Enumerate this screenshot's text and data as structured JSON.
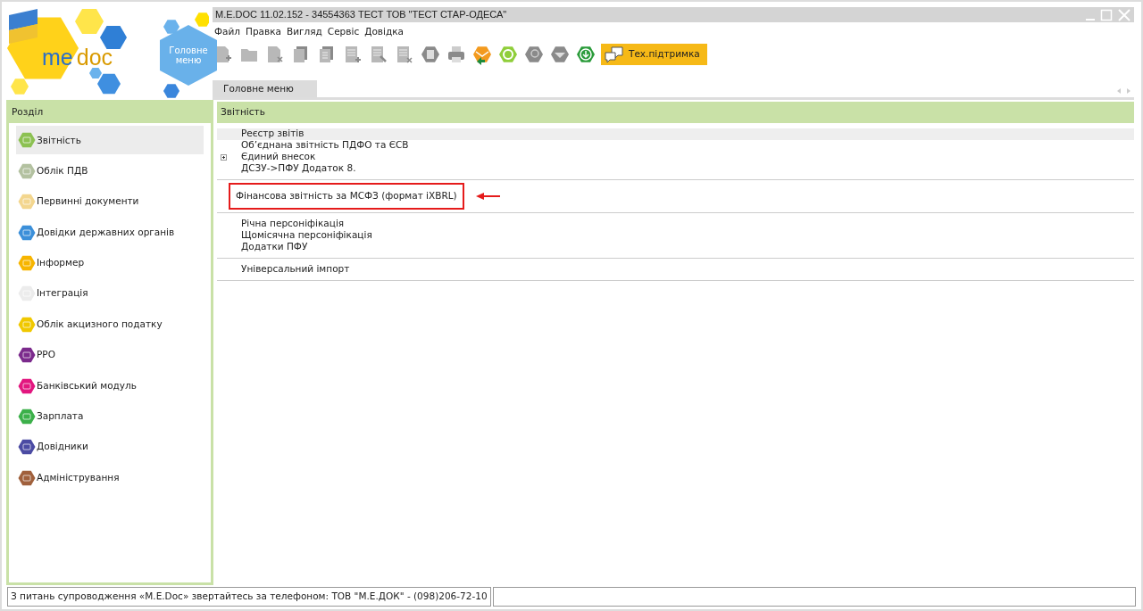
{
  "logo": {
    "text_me": "me",
    "text_doc": "doc"
  },
  "main_menu_button": {
    "line_1": "Головне",
    "line_2": "меню"
  },
  "window": {
    "title": "M.E.DOC 11.02.152  - 34554363 ТЕСТ ТОВ \"ТЕСТ СТАР-ОДЕСА\""
  },
  "menu": [
    "Файл",
    "Правка",
    "Вигляд",
    "Сервіс",
    "Довідка"
  ],
  "support_button": {
    "label": "Тех.підтримка"
  },
  "tabs": [
    {
      "label": "Головне меню",
      "selected": true
    }
  ],
  "sidebar": {
    "title": "Розділ",
    "items": [
      {
        "label": "Звітність",
        "selected": true,
        "color": "#8cc152"
      },
      {
        "label": "Облік ПДВ",
        "selected": false,
        "color": "#b3c1a0"
      },
      {
        "label": "Первинні документи",
        "selected": false,
        "color": "#f3d68e"
      },
      {
        "label": "Довідки державних органів",
        "selected": false,
        "color": "#3b8fd9"
      },
      {
        "label": "Інформер",
        "selected": false,
        "color": "#f7b500"
      },
      {
        "label": "Інтеграція",
        "selected": false,
        "color": "#ececec"
      },
      {
        "label": "Облік акцизного податку",
        "selected": false,
        "color": "#f0c800"
      },
      {
        "label": "РРО",
        "selected": false,
        "color": "#7b2a8c"
      },
      {
        "label": "Банківський модуль",
        "selected": false,
        "color": "#e2167f"
      },
      {
        "label": "Зарплата",
        "selected": false,
        "color": "#3cb04a"
      },
      {
        "label": "Довідники",
        "selected": false,
        "color": "#4b4ba3"
      },
      {
        "label": "Адміністрування",
        "selected": false,
        "color": "#a0603c"
      }
    ]
  },
  "content": {
    "title": "Звітність",
    "groups": [
      [
        {
          "label": "Реєстр звітів",
          "selected": true,
          "expandable": false,
          "annotated": false
        },
        {
          "label": "Об’єднана звітність ПДФО та ЄСВ",
          "selected": false,
          "expandable": false,
          "annotated": false
        },
        {
          "label": "Єдиний внесок",
          "selected": false,
          "expandable": true,
          "annotated": false
        },
        {
          "label": "ДСЗУ->ПФУ Додаток 8.",
          "selected": false,
          "expandable": false,
          "annotated": false
        }
      ],
      [
        {
          "label": "Фінансова звітність за МСФЗ (формат iXBRL)",
          "selected": false,
          "expandable": false,
          "annotated": true
        }
      ],
      [
        {
          "label": "Річна персоніфікація",
          "selected": false,
          "expandable": false,
          "annotated": false
        },
        {
          "label": "Щомісячна персоніфікація",
          "selected": false,
          "expandable": false,
          "annotated": false
        },
        {
          "label": "Додатки ПФУ",
          "selected": false,
          "expandable": false,
          "annotated": false
        }
      ],
      [
        {
          "label": "Універсальний імпорт",
          "selected": false,
          "expandable": false,
          "annotated": false
        }
      ]
    ]
  },
  "status_bar": {
    "text": "З питань супроводження «M.E.Doc» звертайтесь за телефоном: ТОВ \"М.Е.ДОК\" - (098)206-72-10"
  }
}
